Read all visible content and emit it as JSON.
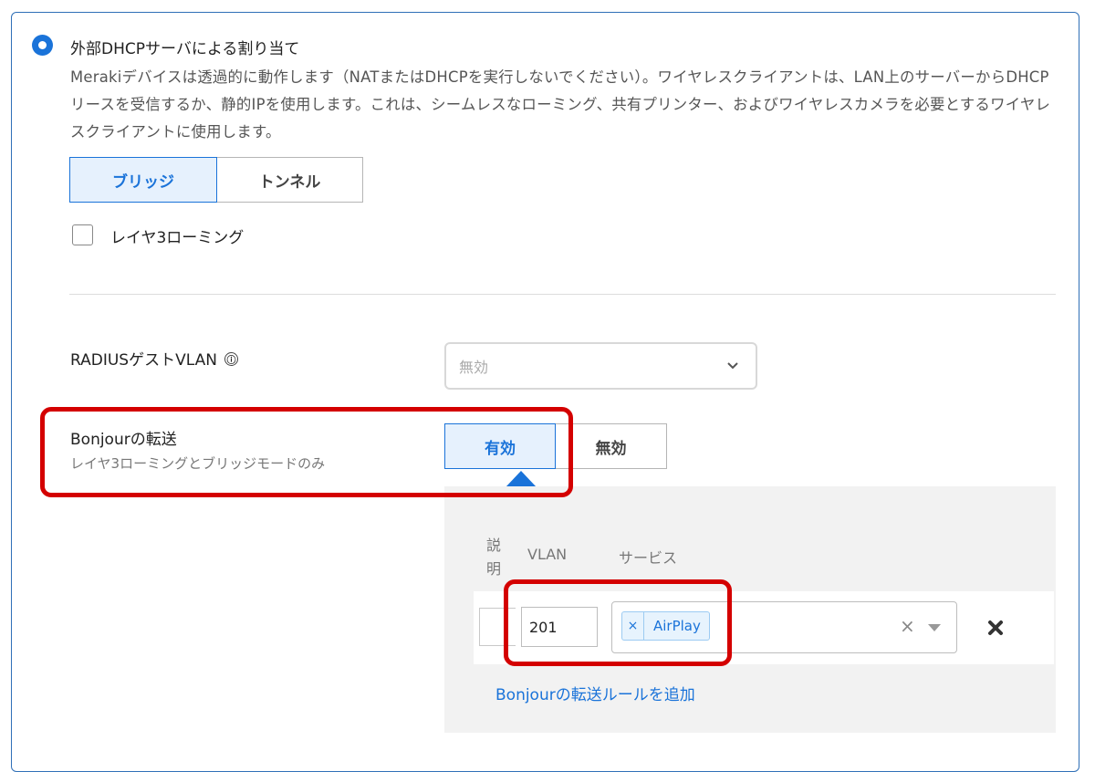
{
  "dhcp": {
    "radio_label": "外部DHCPサーバによる割り当て",
    "description": "Merakiデバイスは透過的に動作します（NATまたはDHCPを実行しないでください）。ワイヤレスクライアントは、LAN上のサーバーからDHCPリースを受信するか、静的IPを使用します。これは、シームレスなローミング、共有プリンター、およびワイヤレスカメラを必要とするワイヤレスクライアントに使用します。"
  },
  "mode_toggle": {
    "options": [
      "ブリッジ",
      "トンネル"
    ],
    "selected": "ブリッジ"
  },
  "layer3_roaming": {
    "label": "レイヤ3ローミング",
    "checked": false
  },
  "radius_guest_vlan": {
    "label": "RADIUSゲストVLAN",
    "info_icon": "ⓘ",
    "select_value": "無効"
  },
  "bonjour": {
    "title": "Bonjourの転送",
    "subtitle": "レイヤ3ローミングとブリッジモードのみ",
    "toggle": {
      "options": [
        "有効",
        "無効"
      ],
      "selected": "有効"
    },
    "columns": {
      "description": "説明",
      "vlan": "VLAN",
      "services": "サービス"
    },
    "rules": [
      {
        "description": "",
        "vlan": "201",
        "services": [
          "AirPlay"
        ]
      }
    ],
    "add_rule_link": "Bonjourの転送ルールを追加"
  },
  "colors": {
    "accent": "#1a73d9",
    "highlight": "#d40000",
    "panel_border": "#2f6fb7"
  }
}
